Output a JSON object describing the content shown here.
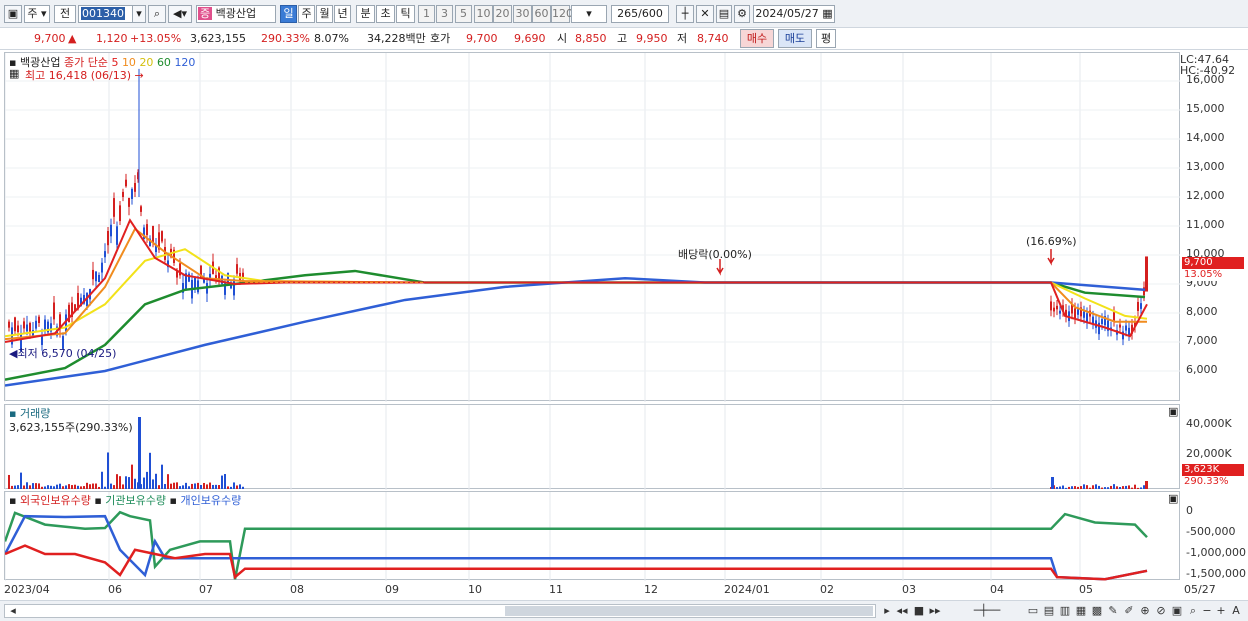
{
  "toolbar": {
    "type_label": "주",
    "prev_label": "전",
    "code_value": "001340",
    "stock_badge": "증",
    "stock_name": "백광산업",
    "periods": [
      "일",
      "주",
      "월",
      "년",
      "분",
      "초",
      "틱"
    ],
    "selected_period": "일",
    "intervals": [
      "1",
      "3",
      "5",
      "10",
      "20",
      "30",
      "60",
      "120"
    ],
    "count_value": "265",
    "count_total": "/600",
    "date_value": "2024/05/27"
  },
  "quote": {
    "price": "9,700",
    "change": "1,120",
    "change_pct": "+13.05%",
    "volume": "3,623,155",
    "volume_ratio": "290.33%",
    "turnover_pct": "8.07%",
    "amount": "34,228백만",
    "ask_label": "호가",
    "ask": "9,700",
    "bid": "9,690",
    "open_label": "시",
    "open": "8,850",
    "high_label": "고",
    "high": "9,950",
    "low_label": "저",
    "low": "8,740",
    "buy_label": "매수",
    "sell_label": "매도",
    "avg_label": "평"
  },
  "price_panel": {
    "stock_label": "백광산업",
    "ma_label": "종가 단순",
    "ma_periods": [
      "5",
      "10",
      "20",
      "60",
      "120"
    ],
    "high_marker": "최고 16,418 (06/13)",
    "low_marker": "최저 6,570 (04/25)",
    "dividend_marker": "배당락(0.00%)",
    "gap_marker": "(16.69%)",
    "lc": "LC:47.64",
    "hc": "HC:-40.92",
    "price_tag": "9,700",
    "pct_tag": "13.05%",
    "y_ticks": [
      "16,000",
      "15,000",
      "14,000",
      "13,000",
      "12,000",
      "11,000",
      "10,000",
      "9,000",
      "8,000",
      "7,000",
      "6,000"
    ]
  },
  "volume_panel": {
    "title": "거래량",
    "value": "3,623,155주(290.33%)",
    "y_ticks": [
      "40,000K",
      "20,000K"
    ],
    "vol_tag": "3,623K",
    "ratio_tag": "290.33%"
  },
  "holding_panel": {
    "labels": [
      "외국인보유수량",
      "기관보유수량",
      "개인보유수량"
    ],
    "y_ticks": [
      "0",
      "-500,000",
      "-1,000,000",
      "-1,500,000"
    ]
  },
  "x_ticks": [
    "2023/04",
    "06",
    "07",
    "08",
    "09",
    "10",
    "11",
    "12",
    "2024/01",
    "02",
    "03",
    "04",
    "05",
    "05/27"
  ],
  "colors": {
    "up": "#d41f1f",
    "down": "#1f4fd4",
    "ma5": "#e02020",
    "ma10": "#f08c1e",
    "ma20": "#f2e21a",
    "ma60": "#1e8c2e",
    "ma120": "#2f5fd6"
  }
}
